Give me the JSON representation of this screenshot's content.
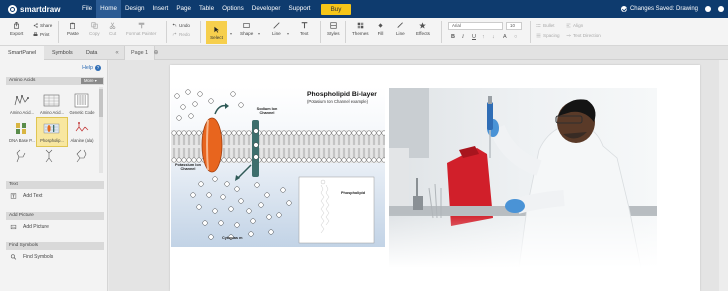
{
  "app": {
    "logo_text": "smartdraw",
    "menu": [
      "File",
      "Home",
      "Design",
      "Insert",
      "Page",
      "Table",
      "Options",
      "Developer",
      "Support"
    ],
    "active_menu": "Home",
    "buy_label": "Buy",
    "saved_status": "Changes Saved: Drawing"
  },
  "ribbon": {
    "export": "Export",
    "share": "Share",
    "print": "Print",
    "paste": "Paste",
    "copy": "Copy",
    "cut": "Cut",
    "format_painter": "Format Painter",
    "undo": "Undo",
    "redo": "Redo",
    "select": "Select",
    "shape": "Shape",
    "line": "Line",
    "text": "Text",
    "styles": "Styles",
    "themes": "Themes",
    "fill": "Fill",
    "line2": "Line",
    "effects": "Effects",
    "font": "Arial",
    "font_size": "10",
    "bullet": "Bullet",
    "align": "Align",
    "spacing": "Spacing",
    "text_direction": "Text Direction",
    "bold": "B",
    "italic": "I",
    "underline": "U"
  },
  "tabs": {
    "smartpanel": "SmartPanel",
    "symbols": "Symbols",
    "data": "Data",
    "page": "Page 1"
  },
  "panel": {
    "help": "Help",
    "library_title": "Amino Acids",
    "more": "More",
    "shapes": [
      "Amino Acid...",
      "Amino Acid...",
      "Genetic Code",
      "DNA Base P...",
      "Phospholip...",
      "Alanine (ala)",
      "",
      "",
      ""
    ],
    "text_section": "Text",
    "add_text": "Add Text",
    "picture_section": "Add Picture",
    "add_picture": "Add Picture",
    "find_section": "Find Symbols",
    "find_symbols": "Find Symbols"
  },
  "diagram": {
    "title": "Phospholipid Bi-layer",
    "subtitle": "(Potasium Ion Channel example)",
    "sodium_label": "Sodium Ion Channel",
    "potassium_label": "Potassium Ion Channel",
    "phospholipid_label": "Phospholipid",
    "cytoplasm_label": "Cytoplas m"
  },
  "colors": {
    "topbar": "#0e3b6e",
    "accent_yellow": "#f5c518",
    "select_highlight": "#f6cf4d",
    "link_blue": "#2f6db5"
  }
}
